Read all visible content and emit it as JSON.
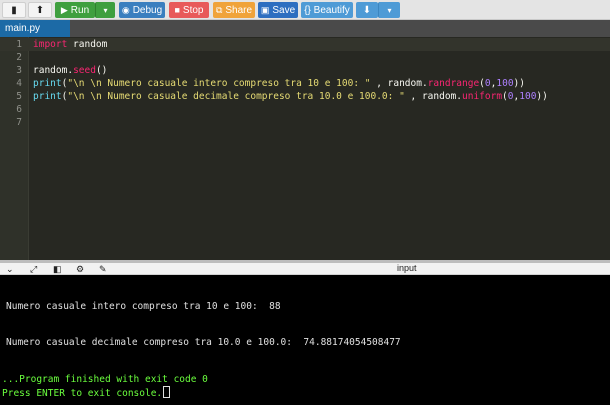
{
  "toolbar": {
    "run_label": "Run",
    "debug_label": "Debug",
    "stop_label": "Stop",
    "share_label": "Share",
    "save_label": "Save",
    "beautify_label": "{} Beautify",
    "colors": {
      "run": "#3f9f3f",
      "debug": "#3a7fbf",
      "stop": "#e85a5a",
      "share": "#f0a33a",
      "save": "#2d6ec0",
      "beautify": "#4e9bd6",
      "download": "#4e9bd6"
    }
  },
  "file_tab": {
    "label": "main.py",
    "color": "#1c6aa6"
  },
  "editor": {
    "line_numbers": [
      "1",
      "2",
      "3",
      "4",
      "5",
      "6",
      "7"
    ],
    "active_line": 1,
    "lines": {
      "l1": {
        "keyword": "import",
        "rest": " random"
      },
      "l3": {
        "obj": "random",
        "dot": ".",
        "method": "seed",
        "args": "()"
      },
      "l4": {
        "fn": "print",
        "open": "(",
        "str": "\"\\n \\n Numero casuale intero compreso tra 10 e 100: \"",
        "sep": " , random.",
        "method": "randrange",
        "p_open": "(",
        "a1": "0",
        "comma": ",",
        "a2": "100",
        "close": "))"
      },
      "l5": {
        "fn": "print",
        "open": "(",
        "str": "\"\\n \\n Numero casuale decimale compreso tra 10.0 e 100.0: \"",
        "sep": " , random.",
        "method": "uniform",
        "p_open": "(",
        "a1": "0",
        "comma": ",",
        "a2": "100",
        "close": "))"
      }
    }
  },
  "console": {
    "title": "input",
    "output": [
      "Numero casuale intero compreso tra 10 e 100:  88",
      "Numero casuale decimale compreso tra 10.0 e 100.0:  74.88174054508477"
    ],
    "exit_message": "...Program finished with exit code 0",
    "prompt": "Press ENTER to exit console."
  }
}
